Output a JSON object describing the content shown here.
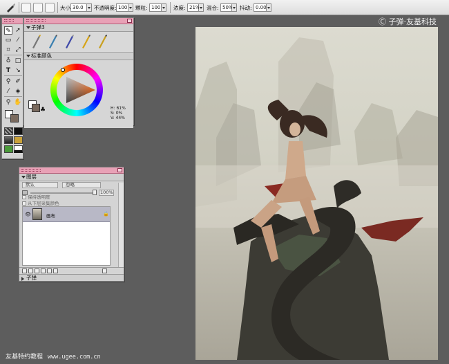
{
  "toolbar": {
    "size_label": "大小:",
    "size_value": "30.0",
    "opacity_label": "不透明度:",
    "opacity_value": "100",
    "grain_label": "颗粒:",
    "grain_value": "100",
    "bleed_label": "浓度:",
    "bleed_value": "21%",
    "mix_label": "混合:",
    "mix_value": "50%",
    "jitter_label": "抖动:",
    "jitter_value": "0.00"
  },
  "brush_panel": {
    "title": "子弹3"
  },
  "color_panel": {
    "title": "标准颜色",
    "h": "H: 61%",
    "s": "S: 0%",
    "v": "V: 44%"
  },
  "layers_panel": {
    "title": "图层",
    "composite_method": "默认",
    "depth_method": "忽略",
    "opacity_value": "100%",
    "preserve_transparency": "保持透明度",
    "pick_up_underlying": "从下层采集颜色",
    "layer_name": "画布",
    "collapsed_section": "子弹"
  },
  "watermark": "Ⓒ 子弹·友基科技",
  "footer": {
    "label": "友基特约教程",
    "url": "www.ugee.com.cn"
  },
  "colors": {
    "palette_header": "#e8a1b6",
    "workspace": "#5d5d5d",
    "current_color": "#7a6a5e"
  }
}
